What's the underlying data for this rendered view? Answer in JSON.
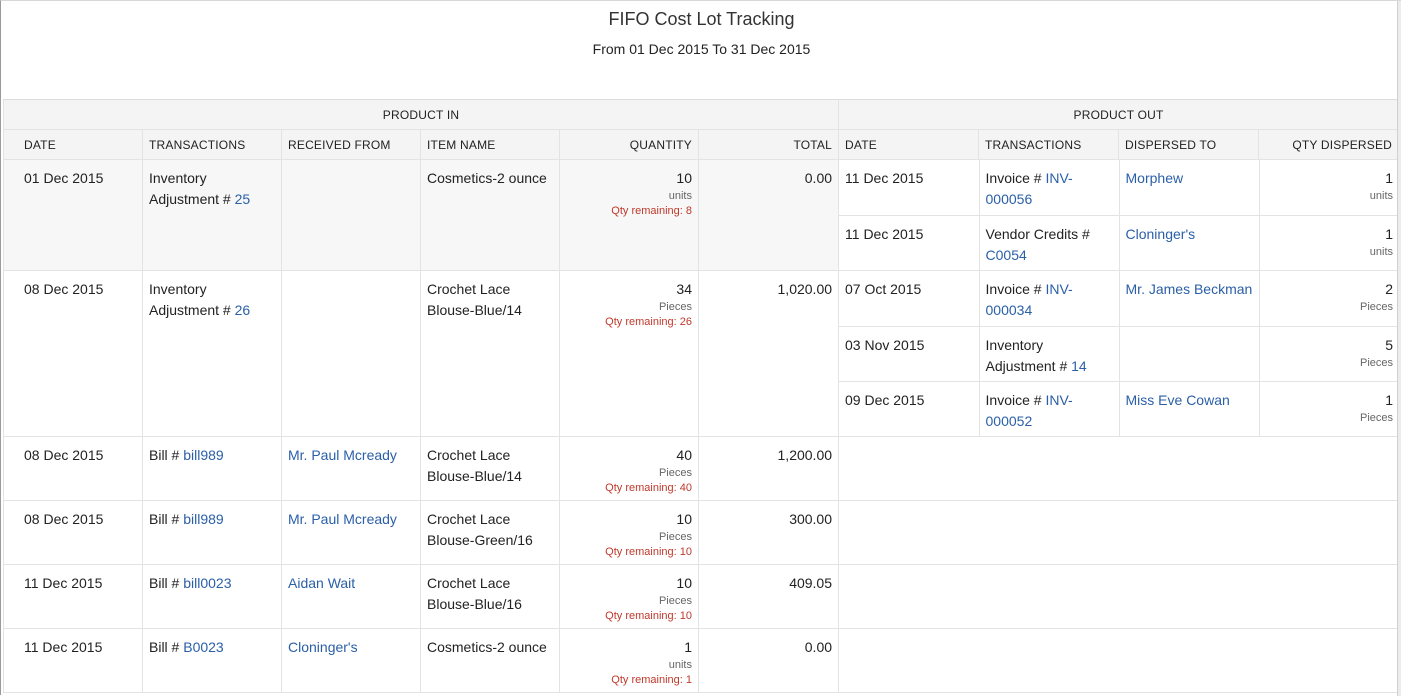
{
  "report": {
    "title": "FIFO Cost Lot Tracking",
    "subtitle": "From 01 Dec 2015 To 31 Dec 2015"
  },
  "headers": {
    "product_in": "PRODUCT IN",
    "product_out": "PRODUCT OUT",
    "date": "DATE",
    "transactions": "TRANSACTIONS",
    "received_from": "RECEIVED FROM",
    "item_name": "ITEM NAME",
    "quantity": "QUANTITY",
    "total": "TOTAL",
    "out_date": "DATE",
    "out_transactions": "TRANSACTIONS",
    "dispersed_to": "DISPERSED TO",
    "qty_dispersed": "QTY DISPERSED"
  },
  "colors": {
    "link": "#2a5fa8",
    "remaining": "#c0392b",
    "header_bg": "#f4f4f4"
  },
  "rows": [
    {
      "date": "01 Dec 2015",
      "txn_prefix": "Inventory Adjustment # ",
      "txn_link": "25",
      "received_from": "",
      "item": "Cosmetics-2 ounce",
      "qty": "10",
      "unit": "units",
      "remaining": "Qty remaining: 8",
      "total": "0.00",
      "out": [
        {
          "date": "11 Dec 2015",
          "txn_prefix": "Invoice # ",
          "txn_link": "INV-000056",
          "to": "Morphew",
          "qty": "1",
          "unit": "units"
        },
        {
          "date": "11 Dec 2015",
          "txn_prefix": "Vendor Credits # ",
          "txn_link": "C0054",
          "to": "Cloninger's",
          "qty": "1",
          "unit": "units"
        }
      ]
    },
    {
      "date": "08 Dec 2015",
      "txn_prefix": "Inventory Adjustment # ",
      "txn_link": "26",
      "received_from": "",
      "item": "Crochet Lace Blouse-Blue/14",
      "qty": "34",
      "unit": "Pieces",
      "remaining": "Qty remaining: 26",
      "total": "1,020.00",
      "out": [
        {
          "date": "07 Oct 2015",
          "txn_prefix": "Invoice # ",
          "txn_link": "INV-000034",
          "to": "Mr. James Beckman",
          "qty": "2",
          "unit": "Pieces"
        },
        {
          "date": "03 Nov 2015",
          "txn_prefix": "Inventory Adjustment # ",
          "txn_link": "14",
          "to": "",
          "qty": "5",
          "unit": "Pieces"
        },
        {
          "date": "09 Dec 2015",
          "txn_prefix": "Invoice # ",
          "txn_link": "INV-000052",
          "to": "Miss Eve Cowan",
          "qty": "1",
          "unit": "Pieces"
        }
      ]
    },
    {
      "date": "08 Dec 2015",
      "txn_prefix": "Bill # ",
      "txn_link": "bill989",
      "received_from": "Mr. Paul Mcready",
      "item": "Crochet Lace Blouse-Blue/14",
      "qty": "40",
      "unit": "Pieces",
      "remaining": "Qty remaining: 40",
      "total": "1,200.00",
      "out": []
    },
    {
      "date": "08 Dec 2015",
      "txn_prefix": "Bill # ",
      "txn_link": "bill989",
      "received_from": "Mr. Paul Mcready",
      "item": "Crochet Lace Blouse-Green/16",
      "qty": "10",
      "unit": "Pieces",
      "remaining": "Qty remaining: 10",
      "total": "300.00",
      "out": []
    },
    {
      "date": "11 Dec 2015",
      "txn_prefix": "Bill # ",
      "txn_link": "bill0023",
      "received_from": "Aidan Wait",
      "item": "Crochet Lace Blouse-Blue/16",
      "qty": "10",
      "unit": "Pieces",
      "remaining": "Qty remaining: 10",
      "total": "409.05",
      "out": []
    },
    {
      "date": "11 Dec 2015",
      "txn_prefix": "Bill # ",
      "txn_link": "B0023",
      "received_from": "Cloninger's",
      "item": "Cosmetics-2 ounce",
      "qty": "1",
      "unit": "units",
      "remaining": "Qty remaining: 1",
      "total": "0.00",
      "out": []
    }
  ]
}
